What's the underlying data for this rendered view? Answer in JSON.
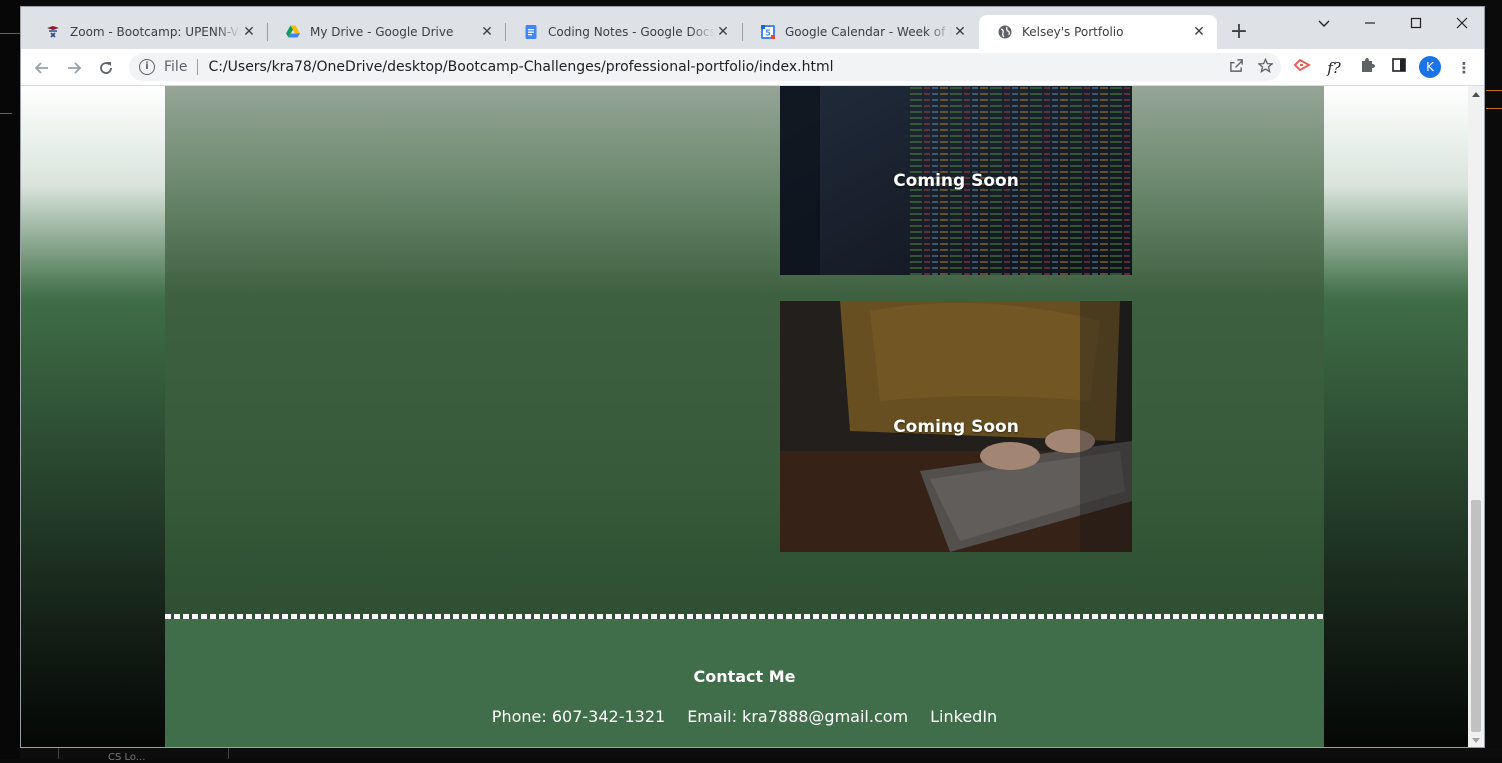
{
  "browser": {
    "tabs": [
      {
        "title": "Zoom - Bootcamp: UPENN-VIRT-",
        "icon": "zoom-icon"
      },
      {
        "title": "My Drive - Google Drive",
        "icon": "google-drive-icon"
      },
      {
        "title": "Coding Notes - Google Docs",
        "icon": "google-docs-icon"
      },
      {
        "title": "Google Calendar - Week of Dece",
        "icon": "google-calendar-icon"
      },
      {
        "title": "Kelsey's Portfolio",
        "icon": "globe-icon",
        "active": true
      }
    ],
    "calendar_day": "5",
    "address_scheme": "File",
    "address_url": "C:/Users/kra78/OneDrive/desktop/Bootcamp-Challenges/professional-portfolio/index.html",
    "profile_initial": "K",
    "accent": "#1a73e8"
  },
  "page": {
    "projects": [
      {
        "label": "Coming Soon"
      },
      {
        "label": "Coming Soon"
      }
    ],
    "footer": {
      "heading": "Contact Me",
      "phone": "Phone: 607-342-1321",
      "email": "Email: kra7888@gmail.com",
      "linkedin": "LinkedIn"
    },
    "colors": {
      "footer_bg": "#416e4a",
      "section_bg": "#365a3a"
    }
  },
  "desktop": {
    "taskbar_text": "CS Lo..."
  }
}
